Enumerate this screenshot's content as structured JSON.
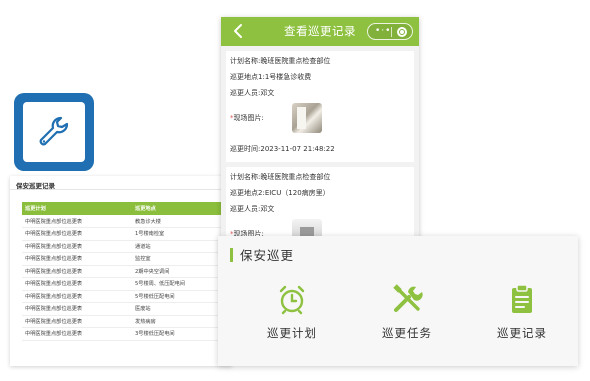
{
  "app_icon": {
    "icon": "wrench-icon",
    "bg_color": "#1f6fb2"
  },
  "table_window": {
    "title": "保安巡更记录",
    "columns": [
      "巡更计划",
      "巡更地点"
    ],
    "rows": [
      [
        "中明医院重点部位巡更表",
        "教急诊大楼"
      ],
      [
        "中明医院重点部位巡更表",
        "1号楼南检室"
      ],
      [
        "中明医院重点部位巡更表",
        "通道站"
      ],
      [
        "中明医院重点部位巡更表",
        "监控室"
      ],
      [
        "中明医院重点部位巡更表",
        "2期中央空调间"
      ],
      [
        "中明医院重点部位巡更表",
        "5号楼周、低压配电间"
      ],
      [
        "中明医院重点部位巡更表",
        "5号楼低压配电间"
      ],
      [
        "中明医院重点部位巡更表",
        "医废站"
      ],
      [
        "中明医院重点部位巡更表",
        "发热病房"
      ],
      [
        "中明医院重点部位巡更表",
        "3号楼低压配电间"
      ]
    ],
    "header_color": "#8bbe3c"
  },
  "phone": {
    "title": "查看巡更记录",
    "back_icon": "chevron-left-icon",
    "menu_icon": "more-dots-icon",
    "close_icon": "target-circle-icon",
    "header_color": "#8dc13f",
    "records": [
      {
        "plan_label": "计划名称:",
        "plan": "晚班医院重点检查部位",
        "location_label": "巡更地点1:",
        "location": "1号楼急诊收费",
        "person_label": "巡更人员:",
        "person": "邓文",
        "photo_label": "现场图片:",
        "time_label": "巡更时间:",
        "time": "2023-11-07 21:48:22"
      },
      {
        "plan_label": "计划名称:",
        "plan": "晚班医院重点检查部位",
        "location_label": "巡更地点2:",
        "location": "EICU（120病房里）",
        "person_label": "巡更人员:",
        "person": "邓文",
        "photo_label": "现场图片:"
      }
    ]
  },
  "patrol_panel": {
    "title": "保安巡更",
    "accent_color": "#8dc13f",
    "actions": [
      {
        "label": "巡更计划",
        "icon": "alarm-clock-icon"
      },
      {
        "label": "巡更任务",
        "icon": "tools-icon"
      },
      {
        "label": "巡更记录",
        "icon": "clipboard-icon"
      }
    ]
  }
}
